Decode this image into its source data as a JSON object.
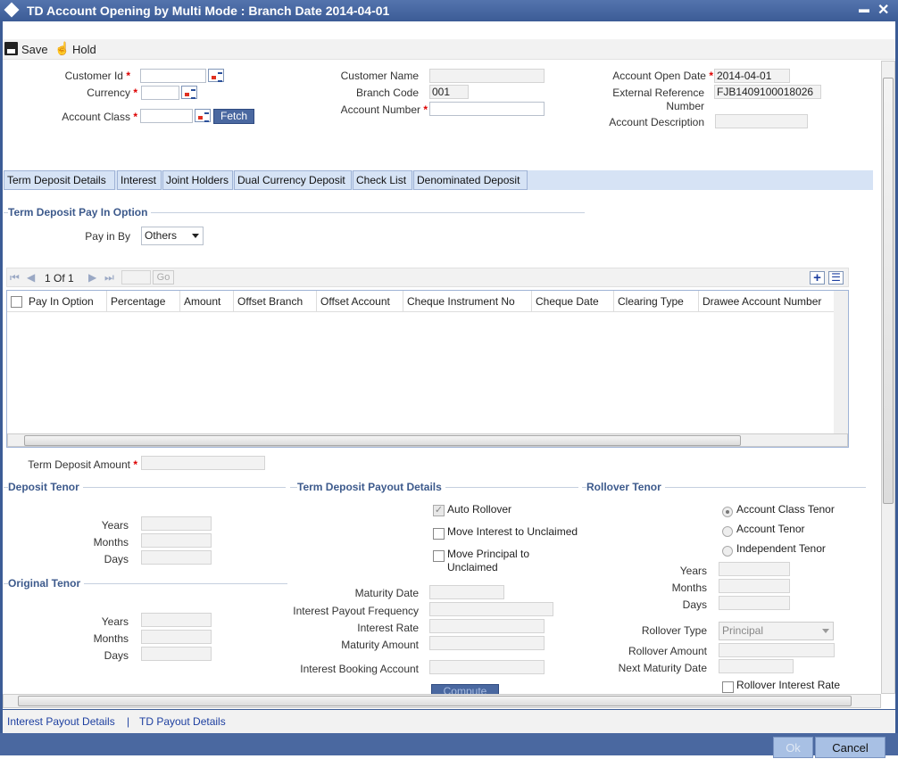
{
  "window": {
    "title": "TD Account Opening by Multi Mode : Branch Date 2014-04-01",
    "minimize": "▬",
    "close": "✕"
  },
  "toolbar": {
    "save": "Save",
    "hold": "Hold"
  },
  "header": {
    "customer_id": {
      "label": "Customer Id",
      "value": ""
    },
    "currency": {
      "label": "Currency",
      "value": ""
    },
    "account_class": {
      "label": "Account Class",
      "value": ""
    },
    "fetch": "Fetch",
    "customer_name": {
      "label": "Customer Name",
      "value": ""
    },
    "branch_code": {
      "label": "Branch Code",
      "value": "001"
    },
    "account_number": {
      "label": "Account Number",
      "value": ""
    },
    "account_open_date": {
      "label": "Account Open Date",
      "value": "2014-04-01"
    },
    "external_reference": {
      "label1": "External Reference",
      "label2": "Number",
      "value": "FJB1409100018026"
    },
    "account_description": {
      "label": "Account Description",
      "value": ""
    },
    "required": "*"
  },
  "tabs": [
    "Term Deposit Details",
    "Interest",
    "Joint Holders",
    "Dual Currency Deposit",
    "Check List",
    "Denominated Deposit"
  ],
  "pay_in": {
    "section": "Term Deposit Pay In Option",
    "pay_in_by_label": "Pay in By",
    "pay_in_by": "Others"
  },
  "grid": {
    "page": "1 Of 1",
    "go": "Go",
    "columns": [
      "Pay In Option",
      "Percentage",
      "Amount",
      "Offset Branch",
      "Offset Account",
      "Cheque Instrument No",
      "Cheque Date",
      "Clearing Type",
      "Drawee Account Number"
    ],
    "rows": []
  },
  "td_amount": {
    "label": "Term Deposit Amount",
    "value": ""
  },
  "deposit_tenor": {
    "section": "Deposit Tenor",
    "years": "Years",
    "months": "Months",
    "days": "Days"
  },
  "original_tenor": {
    "section": "Original Tenor",
    "years": "Years",
    "months": "Months",
    "days": "Days"
  },
  "payout": {
    "section": "Term Deposit Payout Details",
    "auto_rollover": "Auto Rollover",
    "auto_rollover_checked": true,
    "move_interest": "Move Interest to Unclaimed",
    "move_principal1": "Move Principal to",
    "move_principal2": "Unclaimed",
    "maturity_date": "Maturity Date",
    "interest_payout_frequency": "Interest Payout Frequency",
    "interest_rate": "Interest Rate",
    "maturity_amount": "Maturity Amount",
    "interest_booking_account": "Interest Booking Account",
    "compute": "Compute"
  },
  "rollover": {
    "section": "Rollover Tenor",
    "options": [
      "Account Class Tenor",
      "Account Tenor",
      "Independent Tenor"
    ],
    "selected": "Account Class Tenor",
    "years": "Years",
    "months": "Months",
    "days": "Days",
    "rollover_type_label": "Rollover Type",
    "rollover_type": "Principal",
    "rollover_amount": "Rollover Amount",
    "next_maturity_date": "Next Maturity Date",
    "rollover_interest_rate": "Rollover Interest Rate"
  },
  "footer_links": {
    "interest_payout": "Interest Payout Details",
    "sep": "|",
    "td_payout": "TD Payout Details"
  },
  "buttons": {
    "ok": "Ok",
    "cancel": "Cancel"
  }
}
